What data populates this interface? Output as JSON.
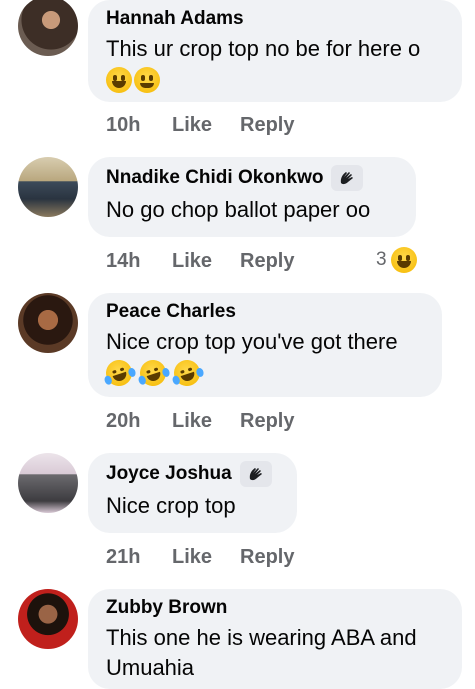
{
  "comments": [
    {
      "name": "Hannah Adams",
      "text": "This ur crop top no be for here o",
      "emojis": [
        "grin-emoji",
        "smile-emoji"
      ],
      "time": "10h",
      "like": "Like",
      "reply": "Reply",
      "avatar_color": "#5b4a3f"
    },
    {
      "name": "Nnadike Chidi Okonkwo",
      "text": "No go chop ballot paper oo",
      "time": "14h",
      "like": "Like",
      "reply": "Reply",
      "reaction_count": "3",
      "avatar_color": "#8a7a5e"
    },
    {
      "name": "Peace Charles",
      "text": "Nice crop top you've got there",
      "emojis": [
        "rofl-emoji",
        "rofl-emoji",
        "rofl-emoji"
      ],
      "time": "20h",
      "like": "Like",
      "reply": "Reply",
      "avatar_color": "#3a2418"
    },
    {
      "name": "Joyce Joshua",
      "text": "Nice crop top",
      "time": "21h",
      "like": "Like",
      "reply": "Reply",
      "avatar_color": "#c9b8c8"
    },
    {
      "name": "Zubby Brown",
      "text": "This one he is wearing ABA and Umuahia",
      "avatar_color": "#c0201c"
    }
  ],
  "colors": {
    "bubble": "#f0f2f5",
    "meta_text": "#65676b",
    "primary_text": "#050505"
  }
}
